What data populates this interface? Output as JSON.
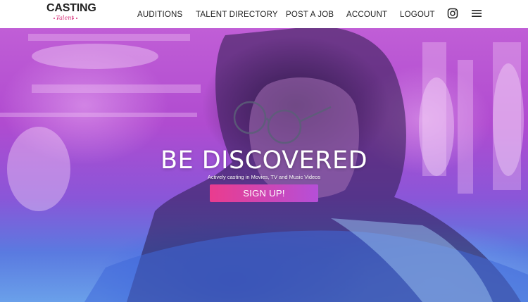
{
  "header": {
    "logo": {
      "main": "CASTING",
      "sub": "Talent"
    },
    "nav": [
      {
        "label": "AUDITIONS"
      },
      {
        "label": "TALENT DIRECTORY"
      },
      {
        "label": "POST A JOB"
      },
      {
        "label": "ACCOUNT"
      },
      {
        "label": "LOGOUT"
      }
    ],
    "icons": [
      "instagram-icon",
      "hamburger-menu-icon"
    ]
  },
  "hero": {
    "title": "BE DISCOVERED",
    "subtitle": "Actively casting in Movies, TV and Music Videos",
    "cta_label": "SIGN UP!"
  },
  "colors": {
    "accent_pink": "#ea3c8e",
    "accent_purple": "#b54fd8",
    "hero_magenta": "#c05ed6",
    "hero_blue": "#5a7ae0"
  }
}
